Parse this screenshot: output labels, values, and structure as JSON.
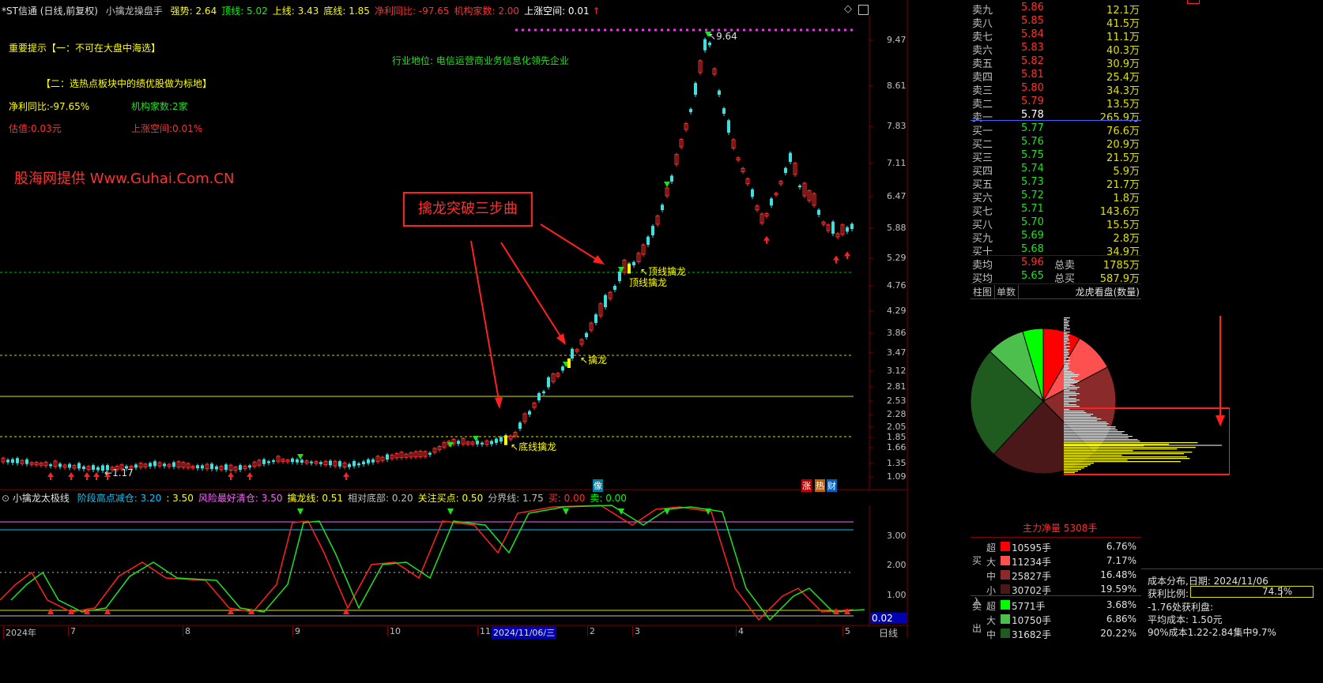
{
  "header": {
    "stock": "*ST信通 (日线,前复权)",
    "indicator": "小擒龙操盘手",
    "items": [
      {
        "label": "强势: 2.64",
        "color": "#ffff00"
      },
      {
        "label": "顶线: 5.02",
        "color": "#00ff00"
      },
      {
        "label": "上线: 3.43",
        "color": "#ffff00"
      },
      {
        "label": "底线: 1.85",
        "color": "#ffff00"
      },
      {
        "label": "净利同比: -97.65",
        "color": "#ff3030"
      },
      {
        "label": "机构家数: 2.00",
        "color": "#ff3030"
      },
      {
        "label": "上涨空间: 0.01",
        "color": "#ffffff"
      }
    ]
  },
  "notes": {
    "tip1": "重要提示【一：不可在大盘中海选】",
    "tip2": "【二：选热点板块中的绩优股做为标地】",
    "profit": "净利同比:-97.65%",
    "inst": "机构家数:2家",
    "value": "估值:0.03元",
    "space": "上涨空间:0.01%",
    "industry": "行业地位: 电信运营商业务信息化领先企业",
    "watermark": "股海网提供 Www.Guhai.Com.CN",
    "callout": "擒龙突破三步曲"
  },
  "chart_labels": {
    "high": "9.64",
    "low": "1.17",
    "top1": "顶线擒龙",
    "top2": "顶线擒龙",
    "mid": "擒龙",
    "bottom": "底线擒龙",
    "tag_zhang": "涨",
    "tag_hot": "热",
    "tag_cai": "财",
    "tag_xiang": "像"
  },
  "price_axis": [
    "9.47",
    "8.61",
    "7.83",
    "7.11",
    "6.47",
    "5.88",
    "5.29",
    "4.76",
    "4.29",
    "3.86",
    "3.47",
    "3.12",
    "2.81",
    "2.53",
    "2.28",
    "2.05",
    "1.85",
    "1.66",
    "1.35",
    "1.09"
  ],
  "sub_header": {
    "name": "小擒龙太极线",
    "items": [
      {
        "label": "阶段高点减仓: 3.20",
        "color": "#00c8ff"
      },
      {
        "label": ": 3.50",
        "color": "#ffff00"
      },
      {
        "label": "风险最好清仓: 3.50",
        "color": "#ff60ff"
      },
      {
        "label": "擒龙线: 0.51",
        "color": "#ffff00"
      },
      {
        "label": "相对底部: 0.20",
        "color": "#c0c0c0"
      },
      {
        "label": "关注买点: 0.50",
        "color": "#ffff00"
      },
      {
        "label": "分界线: 1.75",
        "color": "#c0c0c0"
      },
      {
        "label": "买: 0.00",
        "color": "#ff3030"
      },
      {
        "label": "卖: 0.00",
        "color": "#00ff00"
      }
    ]
  },
  "sub_axis": [
    "3.00",
    "2.00",
    "1.00"
  ],
  "sub_value": "0.02",
  "date_axis": [
    "2024年",
    "7",
    "8",
    "9",
    "10",
    "11",
    "2024/11/06/三",
    "2",
    "3",
    "4",
    "5"
  ],
  "period": "日线",
  "order_book": {
    "sell": [
      {
        "label": "卖九",
        "price": "5.86",
        "vol": "12.1万"
      },
      {
        "label": "卖八",
        "price": "5.85",
        "vol": "41.5万"
      },
      {
        "label": "卖七",
        "price": "5.84",
        "vol": "11.1万"
      },
      {
        "label": "卖六",
        "price": "5.83",
        "vol": "40.3万"
      },
      {
        "label": "卖五",
        "price": "5.82",
        "vol": "30.9万"
      },
      {
        "label": "卖四",
        "price": "5.81",
        "vol": "25.4万"
      },
      {
        "label": "卖三",
        "price": "5.80",
        "vol": "34.3万"
      },
      {
        "label": "卖二",
        "price": "5.79",
        "vol": "13.5万"
      },
      {
        "label": "卖一",
        "price": "5.78",
        "vol": "265.9万"
      }
    ],
    "buy": [
      {
        "label": "买一",
        "price": "5.77",
        "vol": "76.6万"
      },
      {
        "label": "买二",
        "price": "5.76",
        "vol": "20.9万"
      },
      {
        "label": "买三",
        "price": "5.75",
        "vol": "21.5万"
      },
      {
        "label": "买四",
        "price": "5.74",
        "vol": "5.9万"
      },
      {
        "label": "买五",
        "price": "5.73",
        "vol": "21.7万"
      },
      {
        "label": "买六",
        "price": "5.72",
        "vol": "1.8万"
      },
      {
        "label": "买七",
        "price": "5.71",
        "vol": "143.6万"
      },
      {
        "label": "买八",
        "price": "5.70",
        "vol": "15.5万"
      },
      {
        "label": "买九",
        "price": "5.69",
        "vol": "2.8万"
      },
      {
        "label": "买十",
        "price": "5.68",
        "vol": "34.9万"
      }
    ],
    "avg_sell_label": "卖均",
    "avg_sell": "5.96",
    "total_sell_label": "总卖",
    "total_sell": "1785万",
    "avg_buy_label": "买均",
    "avg_buy": "5.65",
    "total_buy_label": "总买",
    "total_buy": "587.9万"
  },
  "tabs": {
    "t1": "柱图",
    "t2": "单数",
    "t3": "龙虎看盘(数量)"
  },
  "pie": {
    "net_label": "主力净量 5308手",
    "slices": [
      {
        "value": 10595,
        "color": "#ff0000"
      },
      {
        "value": 11234,
        "color": "#ff5050"
      },
      {
        "value": 25827,
        "color": "#8b2a2a"
      },
      {
        "value": 30702,
        "color": "#4a1818"
      },
      {
        "value": 31682,
        "color": "#1f5a1f"
      },
      {
        "value": 10750,
        "color": "#4cbf4c"
      },
      {
        "value": 5771,
        "color": "#00ff00"
      }
    ]
  },
  "flow": {
    "buy_in": "买入",
    "sell_out": "卖出",
    "rows": [
      {
        "size": "超",
        "color": "#ff0000",
        "amount": "10595手",
        "pct": "6.76%"
      },
      {
        "size": "大",
        "color": "#ff5050",
        "amount": "11234手",
        "pct": "7.17%"
      },
      {
        "size": "中",
        "color": "#8b2a2a",
        "amount": "25827手",
        "pct": "16.48%"
      },
      {
        "size": "小",
        "color": "#4a1818",
        "amount": "30702手",
        "pct": "19.59%"
      },
      {
        "size": "超",
        "color": "#00ff00",
        "amount": "5771手",
        "pct": "3.68%"
      },
      {
        "size": "大",
        "color": "#4cbf4c",
        "amount": "10750手",
        "pct": "6.86%"
      },
      {
        "size": "中",
        "color": "#1f5a1f",
        "amount": "31682手",
        "pct": "20.22%"
      }
    ]
  },
  "cost": {
    "title": "成本分布,日期: 2024/11/06",
    "profit_label": "获利比例:",
    "profit_value": "74.5%",
    "profit_fraction": 0.745,
    "line2": "-1.76处获利盘:",
    "line3": "平均成本: 1.50元",
    "line4": "90%成本1.22-2.84集中9.7%"
  }
}
